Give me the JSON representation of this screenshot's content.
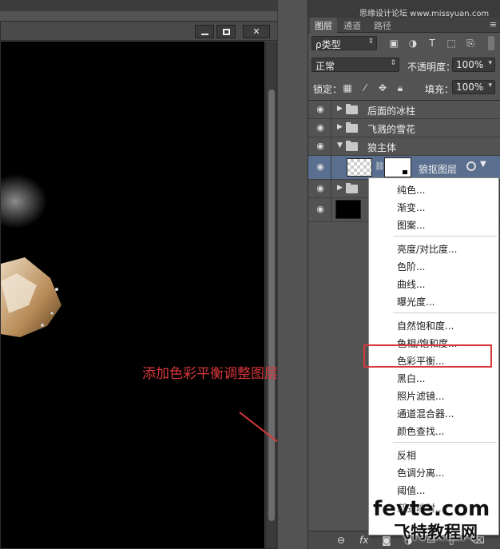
{
  "watermark_top": "思缘设计论坛 www.missyuan.com",
  "annotation": "添加色彩平衡调整图层",
  "document_window": {
    "minimize_label": "",
    "maximize_label": "",
    "close_label": "✕"
  },
  "panel": {
    "tabs": [
      "图层",
      "通道",
      "路径"
    ],
    "filter_value": "ρ类型",
    "blend_mode": "正常",
    "opacity_label": "不透明度：",
    "opacity_value": "100%",
    "lock_label": "锁定：",
    "fill_label": "填充：",
    "fill_value": "100%"
  },
  "layers": [
    {
      "name": "后面的冰柱",
      "type": "group",
      "expanded": false
    },
    {
      "name": "飞溅的雪花",
      "type": "group",
      "expanded": false
    },
    {
      "name": "狼主体",
      "type": "group",
      "expanded": true
    },
    {
      "name": "狼抠图层",
      "type": "layer",
      "selected": true
    },
    {
      "name": "",
      "type": "group",
      "expanded": false
    },
    {
      "name": "",
      "type": "fill-black"
    }
  ],
  "menu": {
    "groups": [
      [
        "纯色...",
        "渐变...",
        "图案..."
      ],
      [
        "亮度/对比度...",
        "色阶...",
        "曲线...",
        "曝光度..."
      ],
      [
        "自然饱和度...",
        "色相/饱和度...",
        "色彩平衡...",
        "黑白...",
        "照片滤镜...",
        "通道混合器...",
        "颜色查找..."
      ],
      [
        "反相",
        "色调分离...",
        "阈值...",
        "渐变映射..."
      ]
    ],
    "highlighted": "色彩平衡..."
  },
  "bottom_icons": [
    "link-icon",
    "fx-icon",
    "mask-icon",
    "adjustment-icon",
    "folder-icon",
    "new-layer-icon",
    "trash-icon"
  ],
  "site_watermark": {
    "en": "fevte.com",
    "cn": "飞特教程网"
  },
  "colors": {
    "annotation": "#d8383c",
    "canvas": "#000000",
    "panel": "#535353",
    "selected_layer": "#5a6f8f"
  }
}
